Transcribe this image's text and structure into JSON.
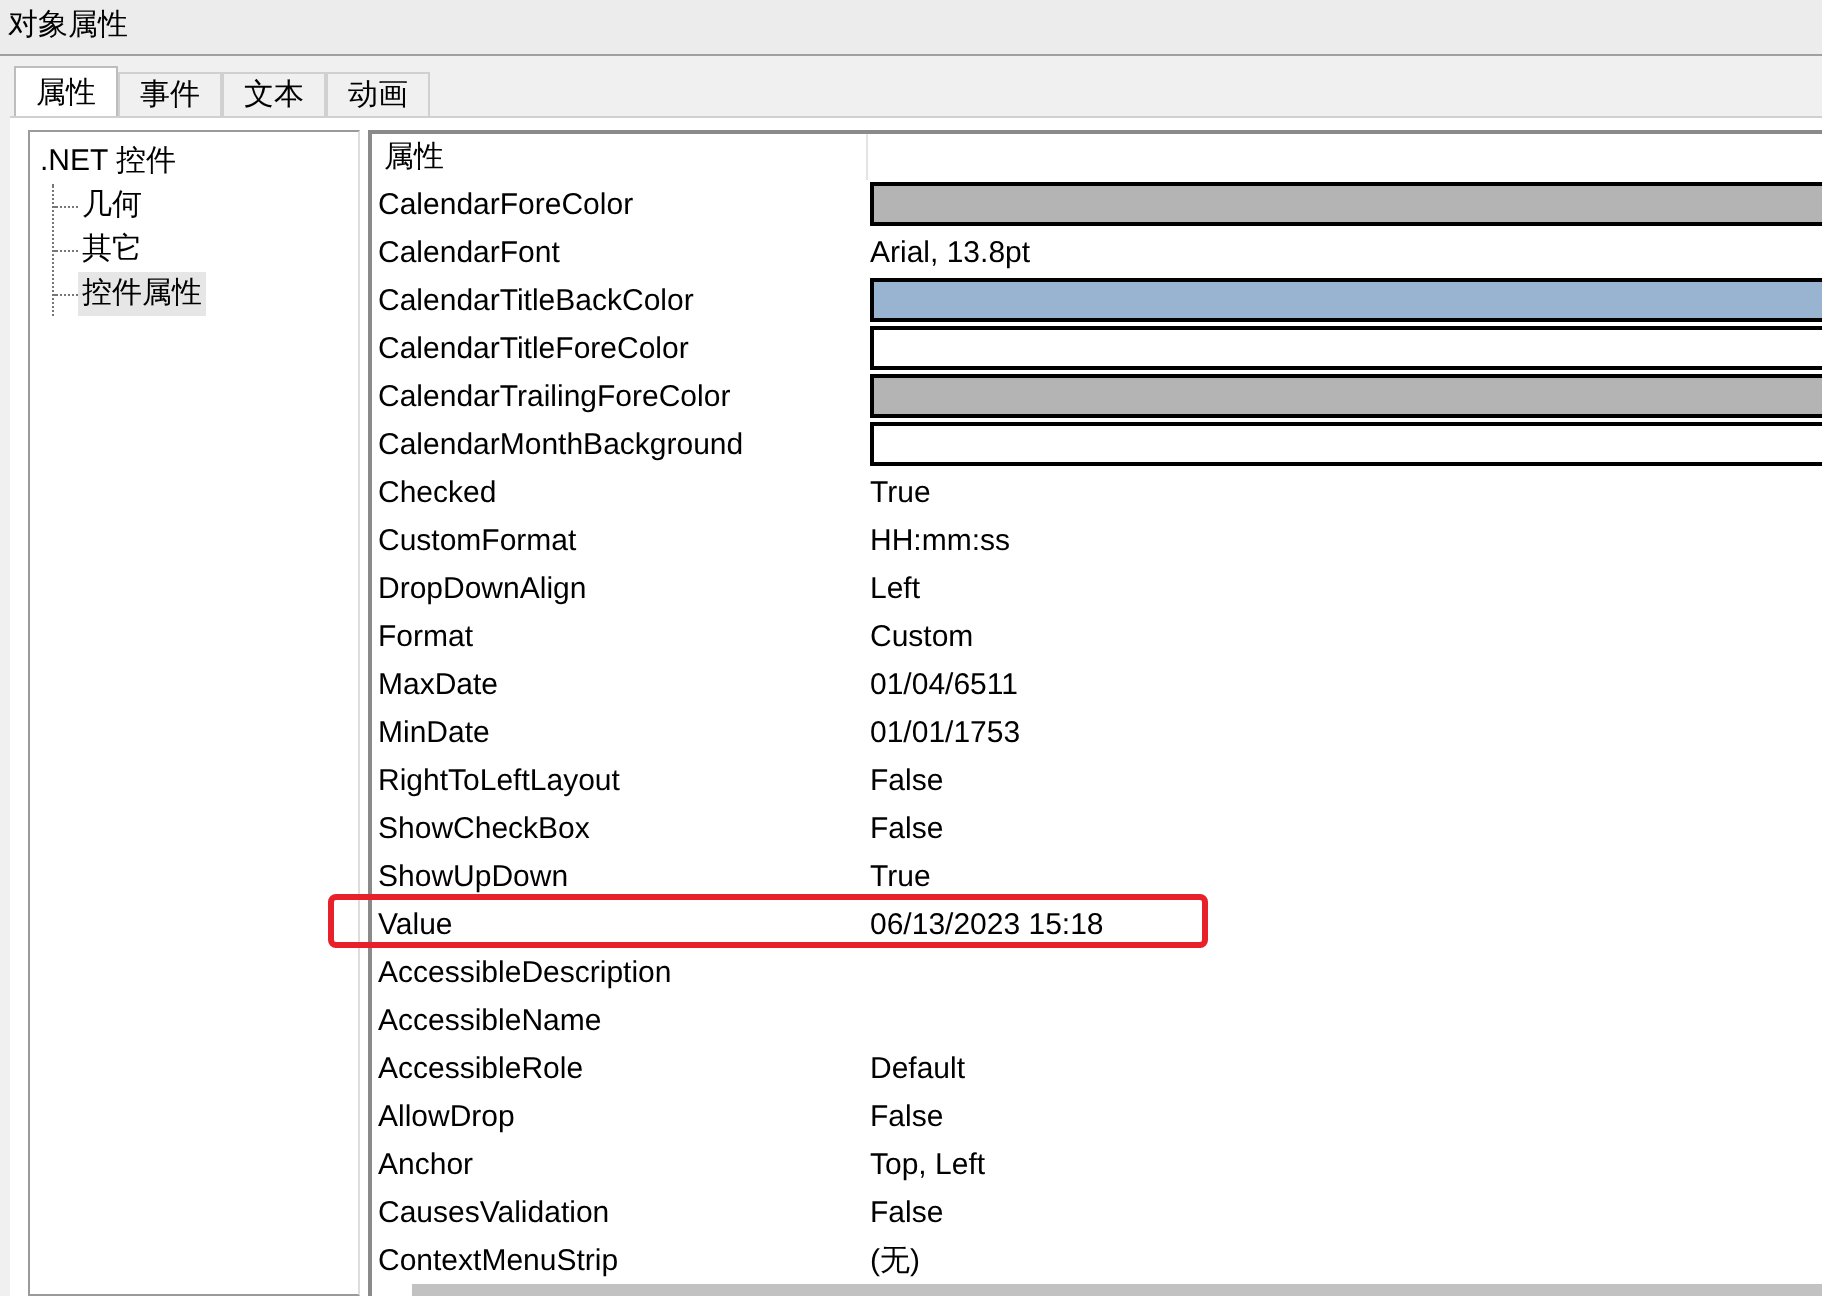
{
  "window": {
    "title": "对象属性"
  },
  "tabs": [
    {
      "label": "属性",
      "selected": true
    },
    {
      "label": "事件",
      "selected": false
    },
    {
      "label": "文本",
      "selected": false
    },
    {
      "label": "动画",
      "selected": false
    }
  ],
  "tree": {
    "label": ".NET 控件",
    "selected": false,
    "children": [
      {
        "label": "几何",
        "selected": false
      },
      {
        "label": "其它",
        "selected": false
      },
      {
        "label": "控件属性",
        "selected": true
      }
    ]
  },
  "grid": {
    "header": "属性",
    "rows": [
      {
        "name": "CalendarForeColor",
        "kind": "color",
        "color": "#b4b4b4",
        "highlighted": false
      },
      {
        "name": "CalendarFont",
        "kind": "text",
        "value": "Arial, 13.8pt",
        "highlighted": false
      },
      {
        "name": "CalendarTitleBackColor",
        "kind": "color",
        "color": "#99b4d1",
        "highlighted": false
      },
      {
        "name": "CalendarTitleForeColor",
        "kind": "color",
        "color": "#ffffff",
        "highlighted": false
      },
      {
        "name": "CalendarTrailingForeColor",
        "kind": "color",
        "color": "#b4b4b4",
        "highlighted": false
      },
      {
        "name": "CalendarMonthBackground",
        "kind": "color",
        "color": "#ffffff",
        "highlighted": false
      },
      {
        "name": "Checked",
        "kind": "text",
        "value": "True",
        "highlighted": false
      },
      {
        "name": "CustomFormat",
        "kind": "text",
        "value": "HH:mm:ss",
        "highlighted": false
      },
      {
        "name": "DropDownAlign",
        "kind": "text",
        "value": "Left",
        "highlighted": false
      },
      {
        "name": "Format",
        "kind": "text",
        "value": "Custom",
        "highlighted": false
      },
      {
        "name": "MaxDate",
        "kind": "text",
        "value": "01/04/6511",
        "highlighted": false
      },
      {
        "name": "MinDate",
        "kind": "text",
        "value": "01/01/1753",
        "highlighted": false
      },
      {
        "name": "RightToLeftLayout",
        "kind": "text",
        "value": "False",
        "highlighted": false
      },
      {
        "name": "ShowCheckBox",
        "kind": "text",
        "value": "False",
        "highlighted": false
      },
      {
        "name": "ShowUpDown",
        "kind": "text",
        "value": "True",
        "highlighted": false
      },
      {
        "name": "Value",
        "kind": "text",
        "value": "06/13/2023 15:18",
        "highlighted": true
      },
      {
        "name": "AccessibleDescription",
        "kind": "text",
        "highlighted": false
      },
      {
        "name": "AccessibleName",
        "kind": "text",
        "highlighted": false
      },
      {
        "name": "AccessibleRole",
        "kind": "text",
        "value": "Default",
        "highlighted": false
      },
      {
        "name": "AllowDrop",
        "kind": "text",
        "value": "False",
        "highlighted": false
      },
      {
        "name": "Anchor",
        "kind": "text",
        "value": "Top, Left",
        "highlighted": false
      },
      {
        "name": "CausesValidation",
        "kind": "text",
        "value": "False",
        "highlighted": false
      },
      {
        "name": "ContextMenuStrip",
        "kind": "text",
        "value": "(无)",
        "highlighted": false
      }
    ]
  }
}
